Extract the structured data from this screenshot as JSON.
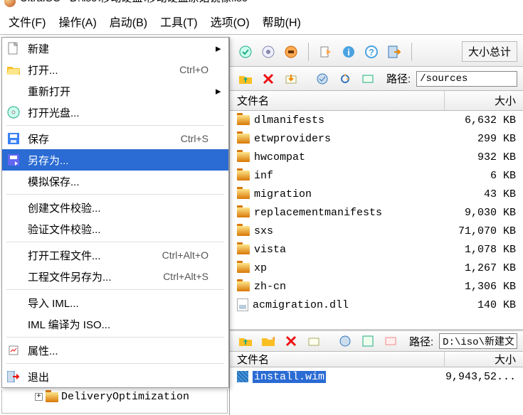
{
  "title_app": "UltraISO",
  "title_path": "D:\\iso\\移动硬盘\\移动硬盘原始镜像.iso",
  "menubar": [
    "文件(F)",
    "操作(A)",
    "启动(B)",
    "工具(T)",
    "选项(O)",
    "帮助(H)"
  ],
  "file_menu": {
    "new": "新建",
    "open": "打开...",
    "open_accel": "Ctrl+O",
    "reopen": "重新打开",
    "open_cd": "打开光盘...",
    "save": "保存",
    "save_accel": "Ctrl+S",
    "save_as": "另存为...",
    "sim_save": "模拟保存...",
    "create_checksum": "创建文件校验...",
    "verify_checksum": "验证文件校验...",
    "open_project": "打开工程文件...",
    "open_project_accel": "Ctrl+Alt+O",
    "save_project_as": "工程文件另存为...",
    "save_project_as_accel": "Ctrl+Alt+S",
    "import_iml": "导入 IML...",
    "compile_iml": "IML 编译为 ISO...",
    "properties": "属性...",
    "exit": "退出"
  },
  "size_total_label": "大小总计",
  "path_label": "路径:",
  "path_top": "/sources",
  "path_bottom": "D:\\iso\\新建文",
  "columns": {
    "name": "文件名",
    "size": "大小"
  },
  "files_top": [
    {
      "type": "folder",
      "name": "dlmanifests",
      "size": "6,632 KB"
    },
    {
      "type": "folder",
      "name": "etwproviders",
      "size": "299 KB"
    },
    {
      "type": "folder",
      "name": "hwcompat",
      "size": "932 KB"
    },
    {
      "type": "folder",
      "name": "inf",
      "size": "6 KB"
    },
    {
      "type": "folder",
      "name": "migration",
      "size": "43 KB"
    },
    {
      "type": "folder",
      "name": "replacementmanifests",
      "size": "9,030 KB"
    },
    {
      "type": "folder",
      "name": "sxs",
      "size": "71,070 KB"
    },
    {
      "type": "folder",
      "name": "vista",
      "size": "1,078 KB"
    },
    {
      "type": "folder",
      "name": "xp",
      "size": "1,267 KB"
    },
    {
      "type": "folder",
      "name": "zh-cn",
      "size": "1,306 KB"
    },
    {
      "type": "dll",
      "name": "acmigration.dll",
      "size": "140 KB"
    }
  ],
  "files_bottom": [
    {
      "type": "wim",
      "name": "install.wim",
      "size": "9,943,52...",
      "selected": true
    }
  ],
  "tree_item": "DeliveryOptimization"
}
